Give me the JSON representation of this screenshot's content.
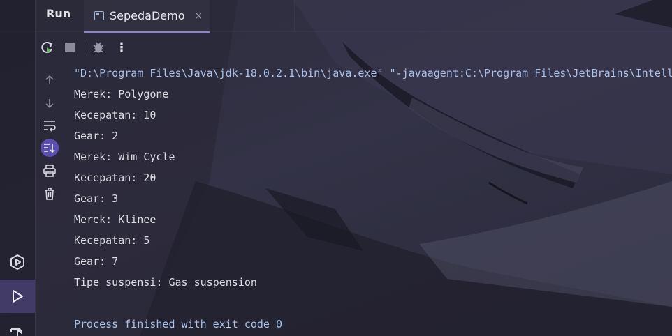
{
  "header": {
    "panel_title": "Run",
    "tab": {
      "label": "SepedaDemo",
      "close_glyph": "×"
    }
  },
  "toolbar": {
    "buttons": [
      "rerun-icon",
      "stop-icon",
      "debug-bug-icon",
      "more-options-icon"
    ],
    "more_glyph": "⋮"
  },
  "side_actions": [
    "arrow-up-icon",
    "arrow-down-icon",
    "soft-wrap-icon",
    "scroll-to-end-icon",
    "print-icon",
    "trash-icon"
  ],
  "left_strip": [
    "services-icon",
    "run-icon",
    "build-hammer-icon"
  ],
  "console": {
    "command": "\"D:\\Program Files\\Java\\jdk-18.0.2.1\\bin\\java.exe\" \"-javaagent:C:\\Program Files\\JetBrains\\Intell",
    "lines": [
      "Merek: Polygone",
      "Kecepatan: 10",
      "Gear: 2",
      "Merek: Wim Cycle",
      "Kecepatan: 20",
      "Gear: 3",
      "Merek: Klinee",
      "Kecepatan: 5",
      "Gear: 7",
      "Tipe suspensi: Gas suspension"
    ],
    "exit": "Process finished with exit code 0"
  },
  "colors": {
    "accent": "#5b4fb0",
    "command_text": "#a8c1e8",
    "output_text": "#dcdce4"
  }
}
